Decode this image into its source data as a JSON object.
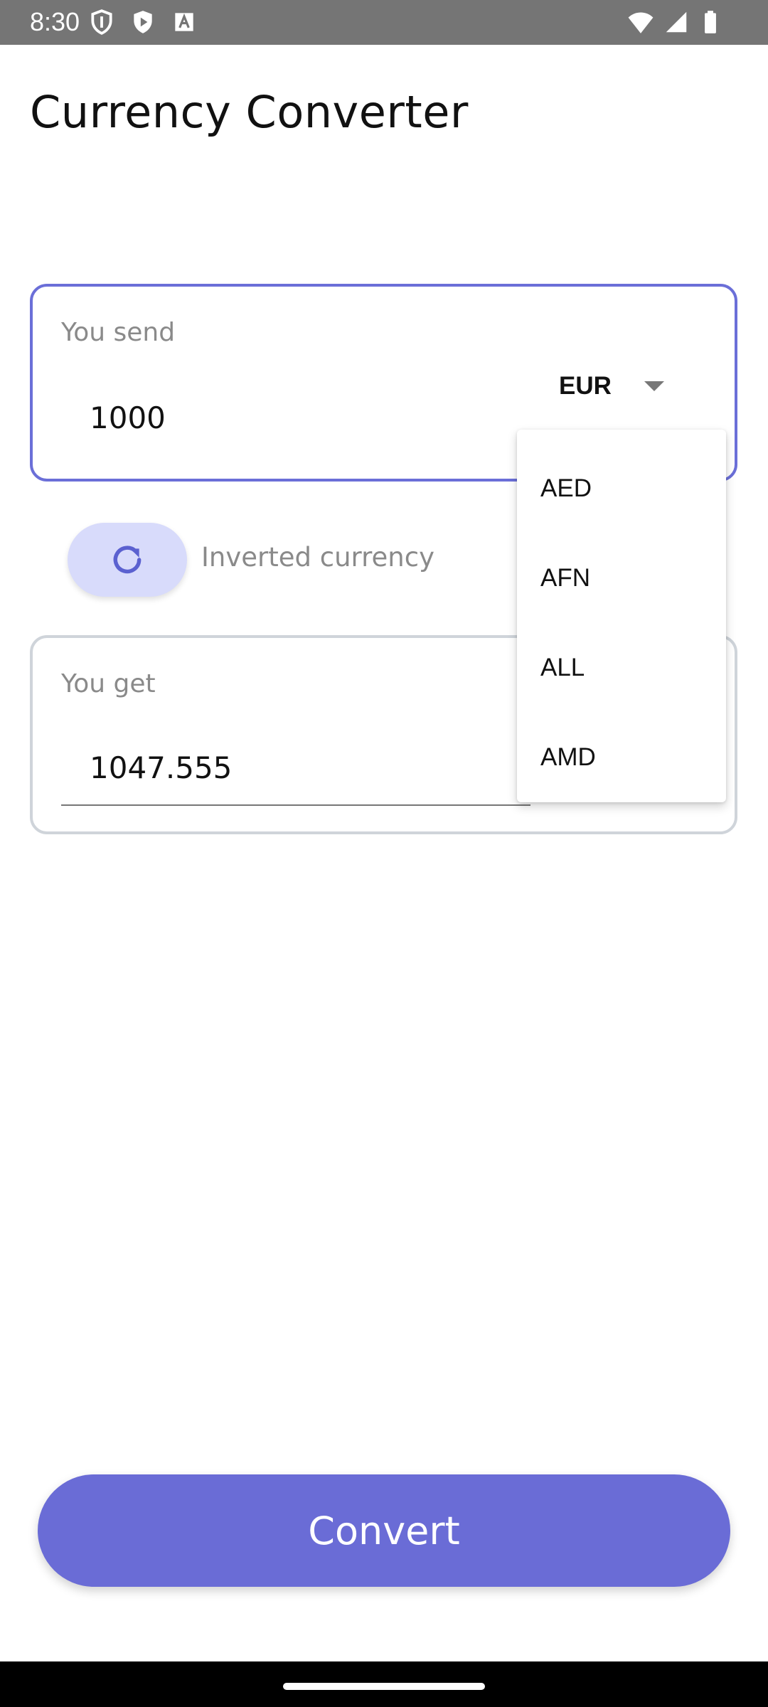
{
  "status_bar": {
    "time": "8:30",
    "left_icons": [
      "shield-icon",
      "play-icon",
      "font-icon"
    ],
    "right_icons": [
      "wifi-icon",
      "signal-icon",
      "battery-icon"
    ]
  },
  "page": {
    "title": "Currency Converter"
  },
  "send": {
    "label": "You send",
    "amount": "1000",
    "currency": "EUR"
  },
  "invert": {
    "label": "Inverted currency",
    "icon": "refresh-icon"
  },
  "get": {
    "label": "You get",
    "amount": "1047.555"
  },
  "dropdown": {
    "options": [
      "AED",
      "AFN",
      "ALL",
      "AMD"
    ]
  },
  "actions": {
    "convert_label": "Convert"
  },
  "colors": {
    "accent": "#6a6cd6",
    "invert_button_bg": "#d8dbfb",
    "active_border": "#6b6fd8",
    "inactive_border": "#cfd4da",
    "status_bar": "#757575"
  }
}
